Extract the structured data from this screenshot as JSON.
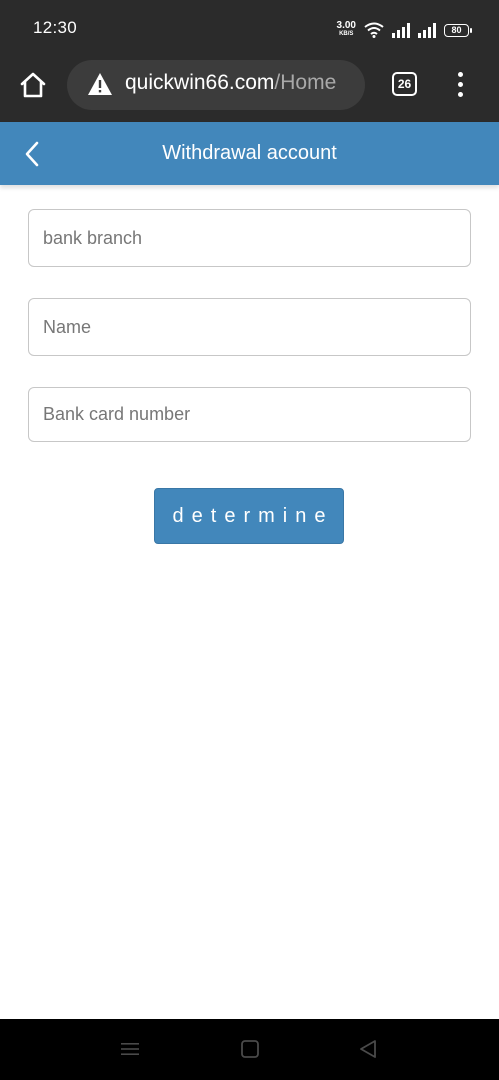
{
  "status_bar": {
    "time": "12:30",
    "net_speed_value": "3.00",
    "net_speed_unit": "KB/S",
    "battery": "80"
  },
  "browser": {
    "url_domain": "quickwin66.com",
    "url_path": "/Home",
    "tab_count": "26"
  },
  "header": {
    "title": "Withdrawal account"
  },
  "form": {
    "bank_branch_placeholder": "bank branch",
    "name_placeholder": "Name",
    "card_number_placeholder": "Bank card number",
    "submit_label": "determine"
  },
  "colors": {
    "header": "#4287bb",
    "status_bar": "#2b2b2b",
    "nav_bar": "#000000"
  },
  "icons": {
    "home": "home-icon",
    "warning": "warning-icon",
    "back": "chevron-left-icon",
    "menu": "more-vertical-icon",
    "nav_recents": "menu-icon",
    "nav_home": "square-icon",
    "nav_back": "triangle-back-icon"
  }
}
